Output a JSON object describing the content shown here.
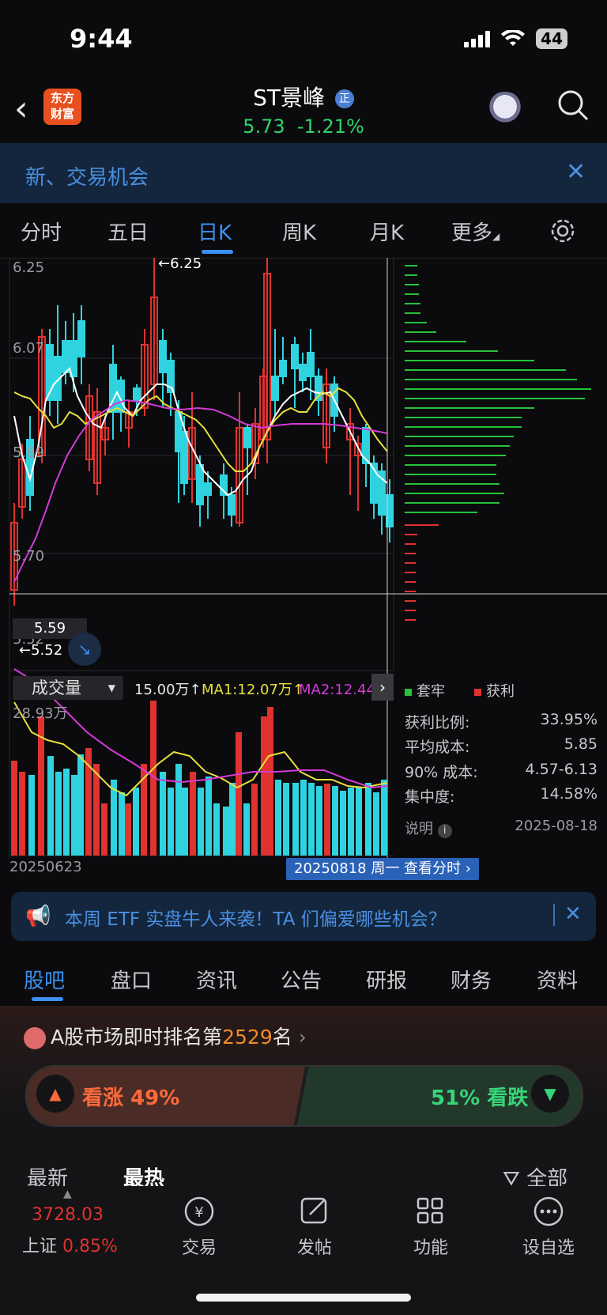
{
  "status": {
    "time": "9:44",
    "battery": "44"
  },
  "header": {
    "logo_line1": "东方",
    "logo_line2": "财富",
    "stock_name": "ST景峰",
    "badge": "正",
    "price": "5.73",
    "change": "-1.21%"
  },
  "banner": {
    "text": "新、交易机会"
  },
  "kline_tabs": [
    "分时",
    "五日",
    "日K",
    "周K",
    "月K",
    "更多"
  ],
  "chart": {
    "high_marker": "6.25",
    "low_marker": "5.52",
    "crosshair_price": "5.59",
    "y_ticks": [
      "6.25",
      "6.07",
      "5.89",
      "5.70",
      "5.52"
    ],
    "start_date": "20250623",
    "selected_date": "20250818 周一 查看分时",
    "vol_max": "28.93万"
  },
  "volume_bar": {
    "label": "成交量",
    "vol": "15.00万",
    "ma1": "MA1:12.07万",
    "ma2": "MA2:12.44万"
  },
  "chips": {
    "legend_trapped": "套牢",
    "legend_profit": "获利",
    "rows": [
      {
        "label": "获利比例:",
        "value": "33.95%"
      },
      {
        "label": "平均成本:",
        "value": "5.85"
      },
      {
        "label": "90% 成本:",
        "value": "4.57-6.13"
      },
      {
        "label": "集中度:",
        "value": "14.58%"
      }
    ],
    "note": "说明",
    "date": "2025-08-18"
  },
  "etf_banner": {
    "text": "本周 ETF 实盘牛人来袭！TA 们偏爱哪些机会？"
  },
  "info_tabs": [
    "股吧",
    "盘口",
    "资讯",
    "公告",
    "研报",
    "财务",
    "资料"
  ],
  "rank": {
    "prefix": "A股市场即时排名第",
    "number": "2529",
    "suffix": "名"
  },
  "sentiment": {
    "bull": "看涨 49%",
    "bear": "51% 看跌"
  },
  "sort": {
    "latest": "最新",
    "hottest": "最热",
    "filter": "全部"
  },
  "bottom_nav": {
    "index_value": "3728.03",
    "index_name": "上证",
    "index_change": "0.85%",
    "items": [
      "交易",
      "发帖",
      "功能",
      "设自选"
    ]
  },
  "colors": {
    "up": "#e0322e",
    "down": "#2fd3e0",
    "green_text": "#2fd36b",
    "accent": "#3b8ff0"
  }
}
